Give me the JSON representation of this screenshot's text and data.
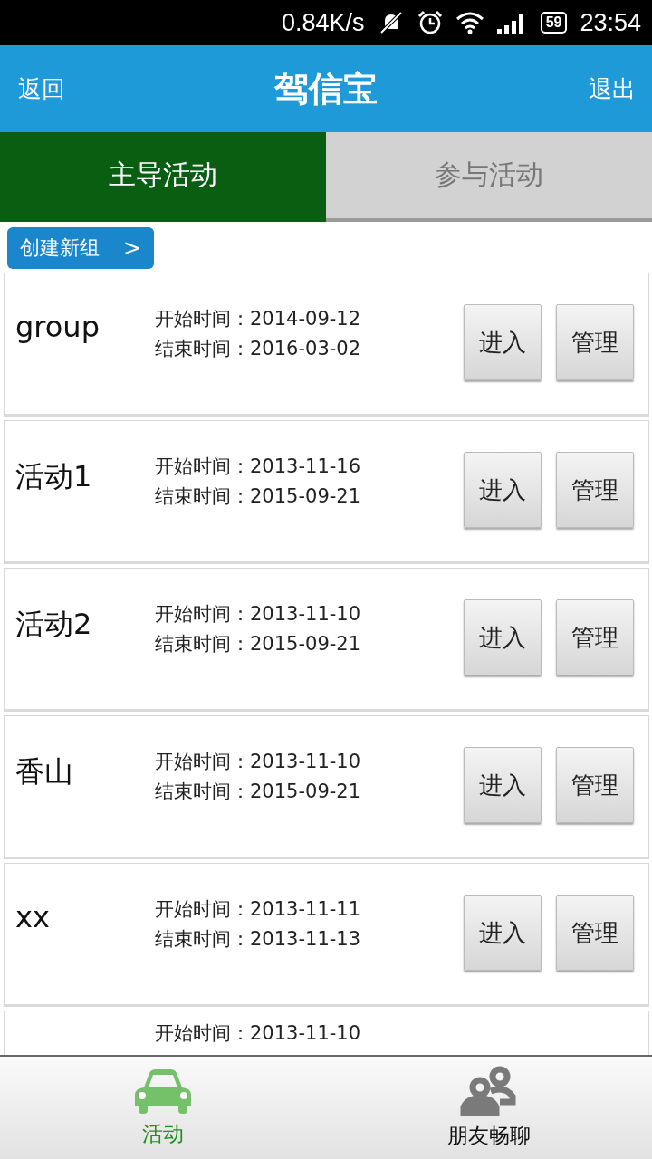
{
  "status_bar": {
    "speed": "0.84K/s",
    "battery": "59",
    "time": "23:54"
  },
  "header": {
    "back": "返回",
    "title": "驾信宝",
    "exit": "退出"
  },
  "tabs": [
    {
      "label": "主导活动",
      "selected": true
    },
    {
      "label": "参与活动",
      "selected": false
    }
  ],
  "create_button": {
    "label": "创建新组",
    "arrow": ">"
  },
  "groups": [
    {
      "name": "group",
      "start": "开始时间：2014-09-12",
      "end": "结束时间：2016-03-02",
      "enter": "进入",
      "manage": "管理"
    },
    {
      "name": "活动1",
      "start": "开始时间：2013-11-16",
      "end": "结束时间：2015-09-21",
      "enter": "进入",
      "manage": "管理"
    },
    {
      "name": "活动2",
      "start": "开始时间：2013-11-10",
      "end": "结束时间：2015-09-21",
      "enter": "进入",
      "manage": "管理"
    },
    {
      "name": "香山",
      "start": "开始时间：2013-11-10",
      "end": "结束时间：2015-09-21",
      "enter": "进入",
      "manage": "管理"
    },
    {
      "name": "xx",
      "start": "开始时间：2013-11-11",
      "end": "结束时间：2013-11-13",
      "enter": "进入",
      "manage": "管理"
    },
    {
      "start": "开始时间：2013-11-10"
    }
  ],
  "bottom_nav": [
    {
      "label": "活动",
      "kind": "car",
      "selected": true
    },
    {
      "label": "朋友畅聊",
      "kind": "people",
      "selected": false
    }
  ]
}
